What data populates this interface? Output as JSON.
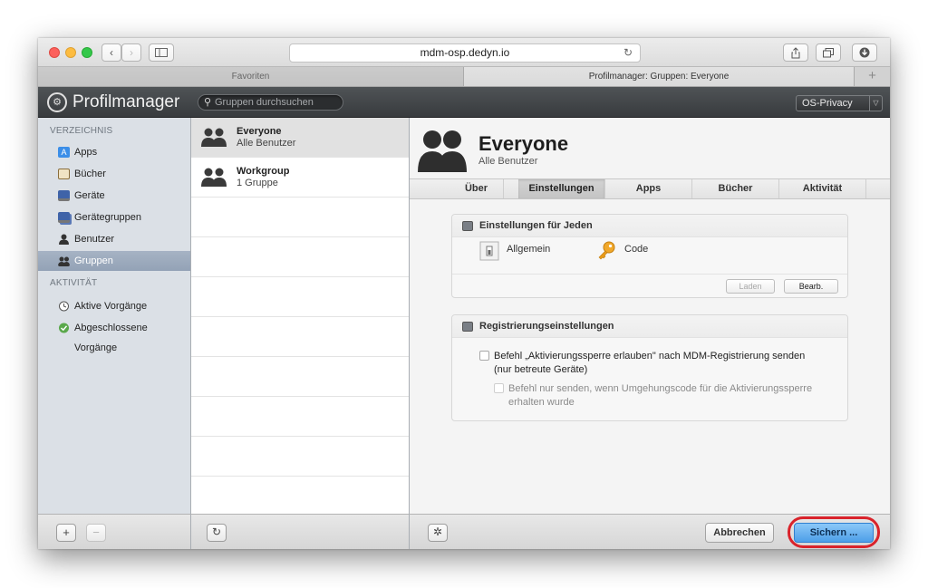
{
  "browser": {
    "url": "mdm-osp.dedyn.io",
    "tabs": [
      {
        "label": "Favoriten"
      },
      {
        "label": "Profilmanager: Gruppen: Everyone"
      }
    ],
    "new_tab_label": "+"
  },
  "app": {
    "title": "Profilmanager",
    "search_placeholder": "Gruppen durchsuchen",
    "server": "OS-Privacy"
  },
  "sidebar": {
    "section_directory": "VERZEICHNIS",
    "section_activity": "AKTIVITÄT",
    "items": [
      {
        "label": "Apps",
        "icon": "apps-icon",
        "color": "#3b8ee8"
      },
      {
        "label": "Bücher",
        "icon": "book-icon",
        "color": "#8a6d3b"
      },
      {
        "label": "Geräte",
        "icon": "device-icon",
        "color": "#3f63a8"
      },
      {
        "label": "Gerätegruppen",
        "icon": "device-group-icon",
        "color": "#3f63a8"
      },
      {
        "label": "Benutzer",
        "icon": "user-icon",
        "color": "#333333"
      },
      {
        "label": "Gruppen",
        "icon": "group-icon",
        "color": "#333333"
      }
    ],
    "activity_items": [
      {
        "label": "Aktive Vorgänge",
        "icon": "clock-icon"
      },
      {
        "label": "Abgeschlossene Vorgänge",
        "icon": "check-icon"
      }
    ],
    "add_label": "+",
    "remove_label": "−"
  },
  "groups": {
    "items": [
      {
        "name": "Everyone",
        "subtitle": "Alle Benutzer"
      },
      {
        "name": "Workgroup",
        "subtitle": "1 Gruppe"
      }
    ],
    "refresh_label": "↻"
  },
  "detail": {
    "title": "Everyone",
    "subtitle": "Alle Benutzer",
    "tabs": [
      "Über",
      "Einstellungen",
      "Apps",
      "Bücher",
      "Aktivität"
    ],
    "settings_panel": {
      "title": "Einstellungen für Jeden",
      "payloads": [
        {
          "label": "Allgemein",
          "icon": "switch-icon"
        },
        {
          "label": "Code",
          "icon": "key-icon"
        }
      ],
      "load_label": "Laden",
      "edit_label": "Bearb."
    },
    "enrollment_panel": {
      "title": "Registrierungseinstellungen",
      "option1_line1": "Befehl „Aktivierungssperre erlauben\" nach MDM-Registrierung senden",
      "option1_line2": "(nur betreute Geräte)",
      "option2_line1": "Befehl nur senden, wenn Umgehungscode für die Aktivierungssperre",
      "option2_line2": "erhalten wurde"
    },
    "gear_label": "✲",
    "cancel_label": "Abbrechen",
    "save_label": "Sichern ..."
  },
  "colors": {
    "accent_save": "#4d9fe8",
    "highlight_ring": "#d9232b",
    "sidebar_selected": "#93a2b6"
  }
}
